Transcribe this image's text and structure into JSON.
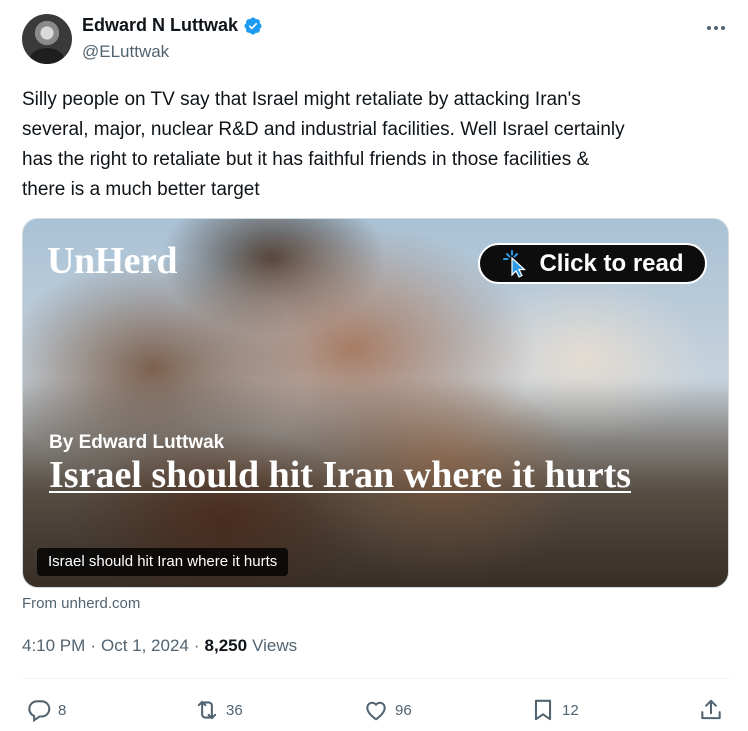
{
  "author": {
    "name": "Edward N Luttwak",
    "handle": "@ELuttwak",
    "verified_color": "#1d9bf0"
  },
  "tweet": {
    "text": "Silly people on TV say that Israel might retaliate by attacking Iran's\nseveral, major, nuclear R&D and industrial facilities. Well Israel certainly\nhas the right to retaliate but it has faithful friends in those facilities &\nthere is a much better target"
  },
  "card": {
    "logo": "UnHerd",
    "cta_label": "Click to read",
    "byline": "By Edward Luttwak",
    "headline": "Israel should hit Iran where it hurts",
    "label": "Israel should hit Iran where it hurts",
    "source": "From unherd.com"
  },
  "meta": {
    "time": "4:10 PM",
    "separator": "·",
    "date": "Oct 1, 2024",
    "views_count": "8,250",
    "views_label": "Views"
  },
  "actions": {
    "replies": "8",
    "reposts": "36",
    "likes": "96",
    "bookmarks": "12"
  },
  "icons": {
    "more": "more-options-icon",
    "verified": "verified-badge-icon",
    "cursor": "pointer-cursor-icon",
    "reply": "reply-icon",
    "repost": "repost-icon",
    "like": "like-icon",
    "bookmark": "bookmark-icon",
    "share": "share-icon"
  },
  "colors": {
    "text": "#0f1419",
    "muted": "#536471",
    "accent": "#1d9bf0",
    "card_button": "#0d0d0d"
  }
}
